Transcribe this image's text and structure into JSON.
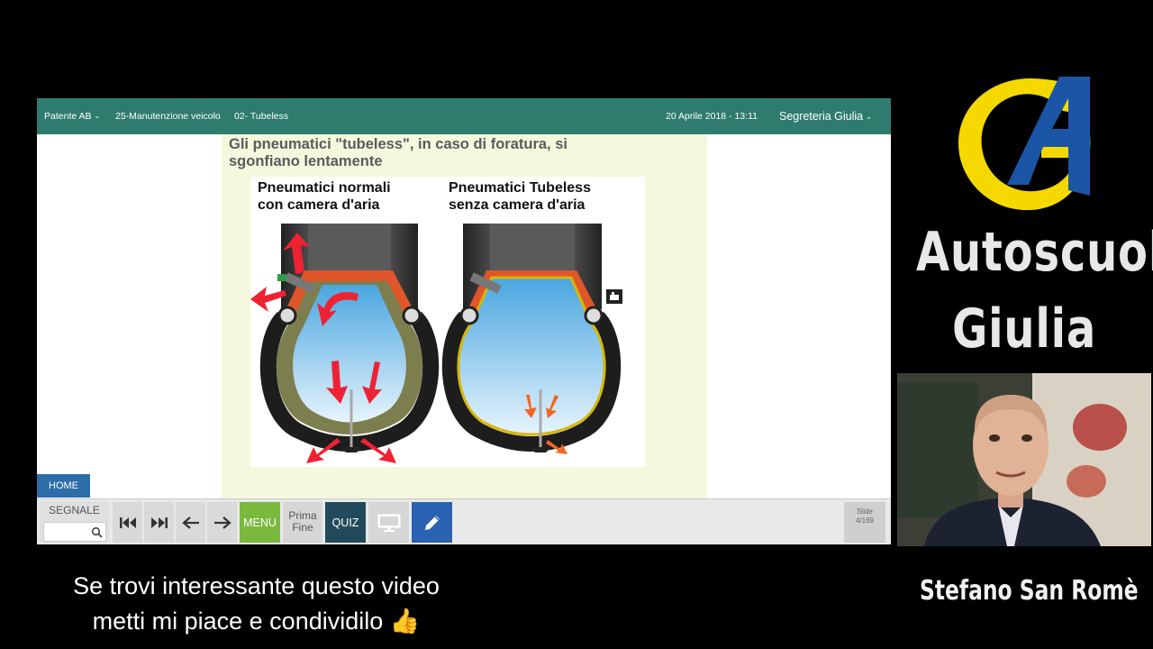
{
  "topbar": {
    "course": "Patente AB",
    "chapter": "25-Manutenzione veicolo",
    "lesson": "02- Tubeless",
    "datetime": "20 Aprile 2018 - 13:11",
    "user": "Segreteria Giulia"
  },
  "slide": {
    "title_line1": "Gli pneumatici \"tubeless\", in caso di foratura, si",
    "title_line2": "sgonfiano lentamente",
    "caption_left_line1": "Pneumatici normali",
    "caption_left_line2": "con camera d'aria",
    "caption_right_line1": "Pneumatici Tubeless",
    "caption_right_line2": "senza camera d'aria"
  },
  "home_button": "HOME",
  "toolbar": {
    "segnale_label": "SEGNALE",
    "segnale_value": "",
    "menu_label": "MENU",
    "prima_label": "Prima",
    "fine_label": "Fine",
    "quiz_label": "QUIZ",
    "slide_label": "Slide",
    "slide_counter": "4/169"
  },
  "icons": [
    "search-icon",
    "first-slide-icon",
    "last-slide-icon",
    "previous-arrow-icon",
    "next-arrow-icon",
    "screen-icon",
    "pen-icon",
    "camera-icon"
  ],
  "colors": {
    "topbar": "#2f7b6e",
    "menu": "#7ab83e",
    "quiz": "#234a5a",
    "pen": "#2a61b0",
    "home": "#2d6ea8",
    "slide_background": "#f5f8dd",
    "logo_yellow": "#f5d800",
    "logo_blue": "#1b56a6"
  },
  "brand": {
    "line1": "Autoscuola",
    "line2": "Giulia",
    "presenter": "Stefano San Romè"
  },
  "video_caption": {
    "line1": "Se trovi interessante questo video",
    "line2": "metti mi piace e condividilo 👍"
  }
}
